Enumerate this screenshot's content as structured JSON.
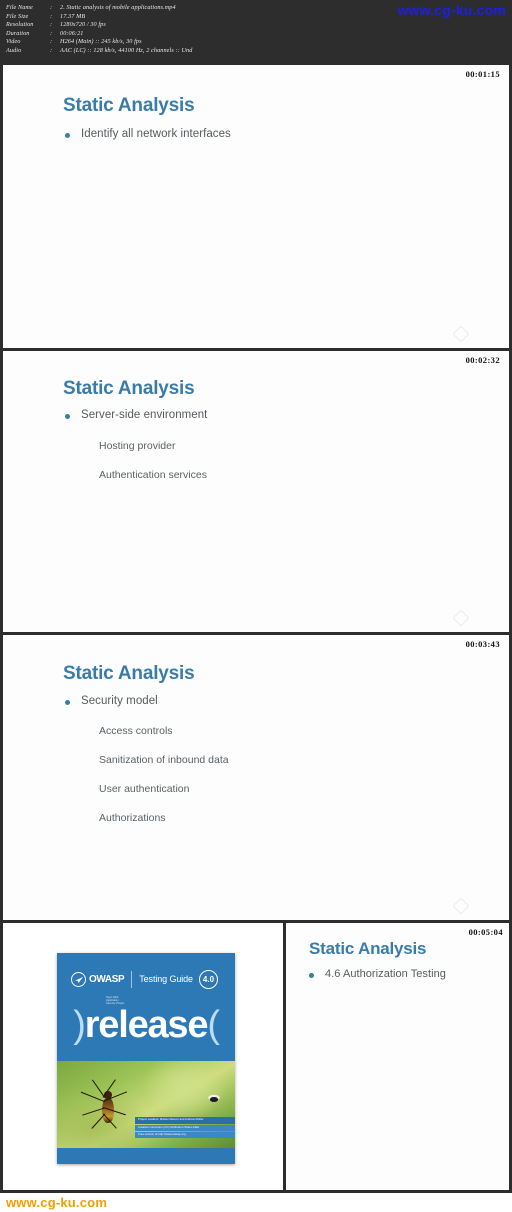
{
  "header": {
    "watermark": "www.cg-ku.com",
    "metadata": [
      {
        "key": "File Name",
        "sep": ":",
        "value": "2. Static analysis of mobile applications.mp4"
      },
      {
        "key": "File Size",
        "sep": ":",
        "value": "17.37 MB"
      },
      {
        "key": "Resolution",
        "sep": ":",
        "value": "1280x720 / 30 fps"
      },
      {
        "key": "Duration",
        "sep": ":",
        "value": "00:06:21"
      },
      {
        "key": "Video",
        "sep": ":",
        "value": "H264 (Main) :: 245 kb/s, 30 fps"
      },
      {
        "key": "Audio",
        "sep": ":",
        "value": "AAC (LC) :: 128 kb/s, 44100 Hz, 2 channels :: Und"
      }
    ]
  },
  "panels": [
    {
      "timestamp": "00:01:15",
      "title": "Static Analysis",
      "bullets": [
        "Identify all network interfaces"
      ],
      "sub_bullets": []
    },
    {
      "timestamp": "00:02:32",
      "title": "Static Analysis",
      "bullets": [
        "Server-side environment"
      ],
      "sub_bullets": [
        "Hosting provider",
        "Authentication services"
      ]
    },
    {
      "timestamp": "00:03:43",
      "title": "Static Analysis",
      "bullets": [
        "Security model"
      ],
      "sub_bullets": [
        "Access controls",
        "Sanitization of inbound data",
        "User authentication",
        "Authorizations"
      ]
    },
    {
      "timestamp": "00:05:04",
      "title": "Static Analysis",
      "bullets": [
        "4.6 Authorization Testing"
      ],
      "sub_bullets": []
    }
  ],
  "book_cover": {
    "brand": "OWASP",
    "brand_tagline": "Open Web Application Security Project",
    "guide_label": "Testing Guide",
    "version": "4.0",
    "headline": "release",
    "paren_open": ")",
    "paren_close": "(",
    "credits": [
      "Project Leaders: Matteo Meucci and Andrew Muller",
      "Creative Commons (CC) Attribution Share-Alike",
      "Free version at http://www.owasp.org"
    ]
  },
  "footer": {
    "watermark": "www.cg-ku.com"
  },
  "colors": {
    "title_blue": "#3a7ca8",
    "bullet_text": "#555b60",
    "header_bg": "#2d2d2d",
    "watermark_top": "#1f1fe0",
    "watermark_bottom": "#f0a000",
    "book_blue": "#2d79b5"
  },
  "icons": {
    "corner_logo": "brand-logo-watermark",
    "owasp_mark": "owasp-paper-plane-icon"
  }
}
